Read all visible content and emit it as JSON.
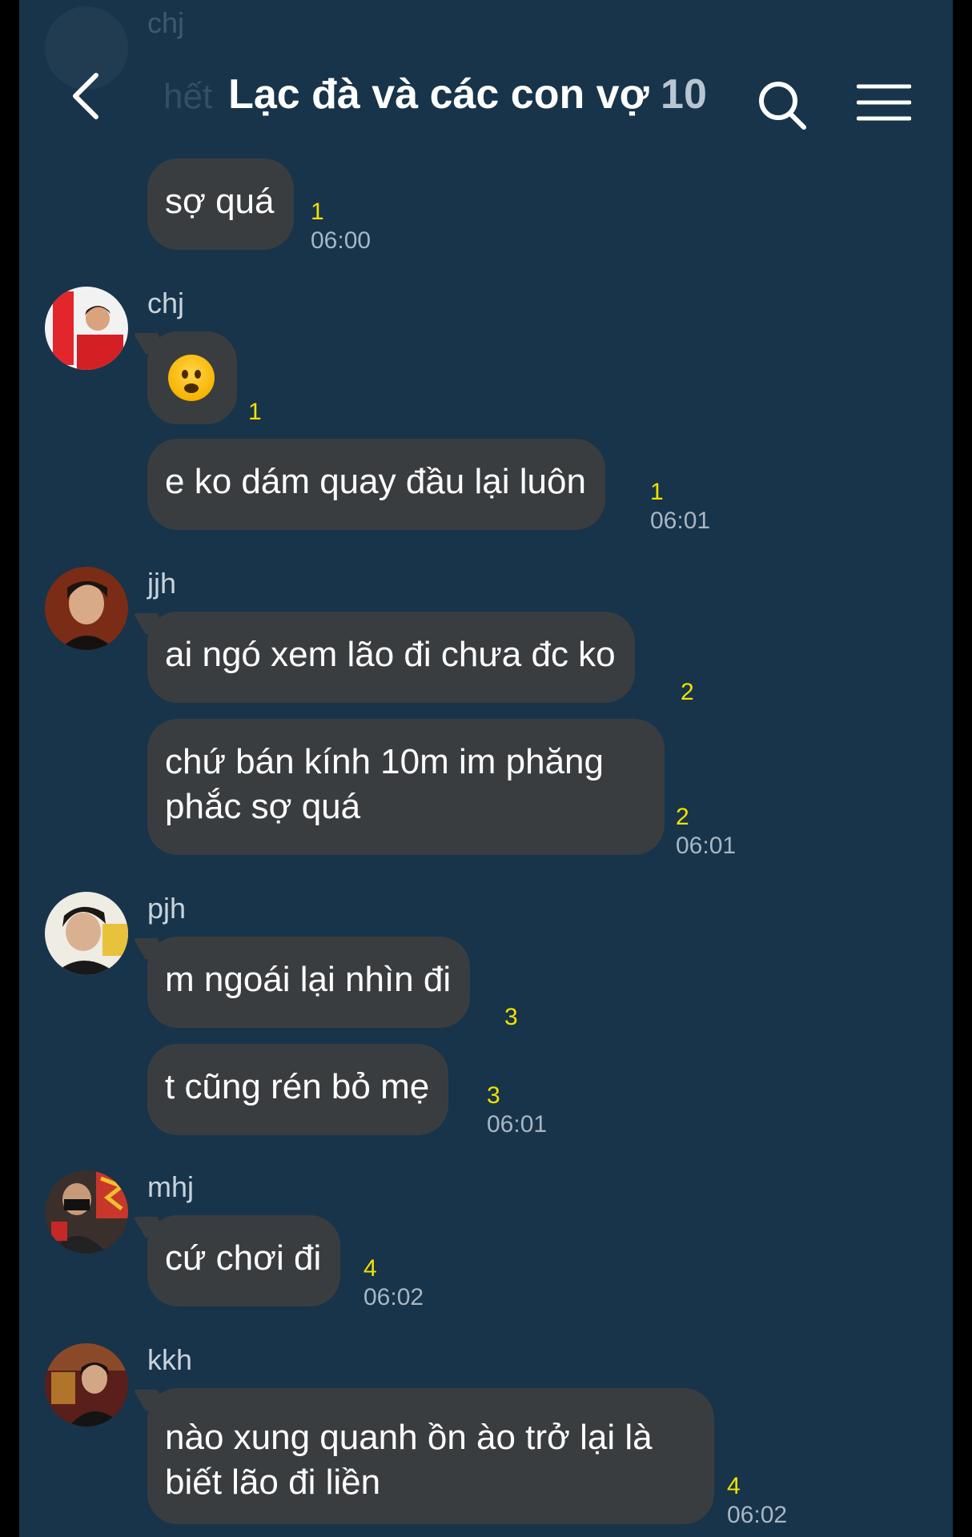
{
  "header": {
    "title": "Lạc đà và các con vợ",
    "member_count": "10",
    "ghost_sender": "chj",
    "ghost_text": "hết",
    "back_icon": "chevron-left-icon",
    "search_icon": "search-icon",
    "menu_icon": "menu-icon"
  },
  "messages": [
    {
      "text": "sợ quá",
      "unread": "1",
      "time": "06:00"
    },
    {
      "sender": "chj",
      "emoji": "frowning-face",
      "unread": "1"
    },
    {
      "text": "e ko dám quay đầu lại luôn",
      "unread": "1",
      "time": "06:01"
    },
    {
      "sender": "jjh",
      "text": "ai ngó xem lão đi chưa đc ko",
      "unread": "2"
    },
    {
      "text": "chứ bán kính 10m im phăng phắc sợ quá",
      "unread": "2",
      "time": "06:01"
    },
    {
      "sender": "pjh",
      "text": "m ngoái lại nhìn đi",
      "unread": "3"
    },
    {
      "text": "t cũng rén bỏ mẹ",
      "unread": "3",
      "time": "06:01"
    },
    {
      "sender": "mhj",
      "text": "cứ chơi đi",
      "unread": "4",
      "time": "06:02"
    },
    {
      "sender": "kkh",
      "text": "nào xung quanh ồn ào trở lại là biết lão đi liền",
      "unread": "4",
      "time": "06:02"
    }
  ],
  "colors": {
    "background": "#17344a",
    "bubble": "#3a3d40",
    "unread": "#f3e100",
    "time": "#a9b6c1"
  }
}
